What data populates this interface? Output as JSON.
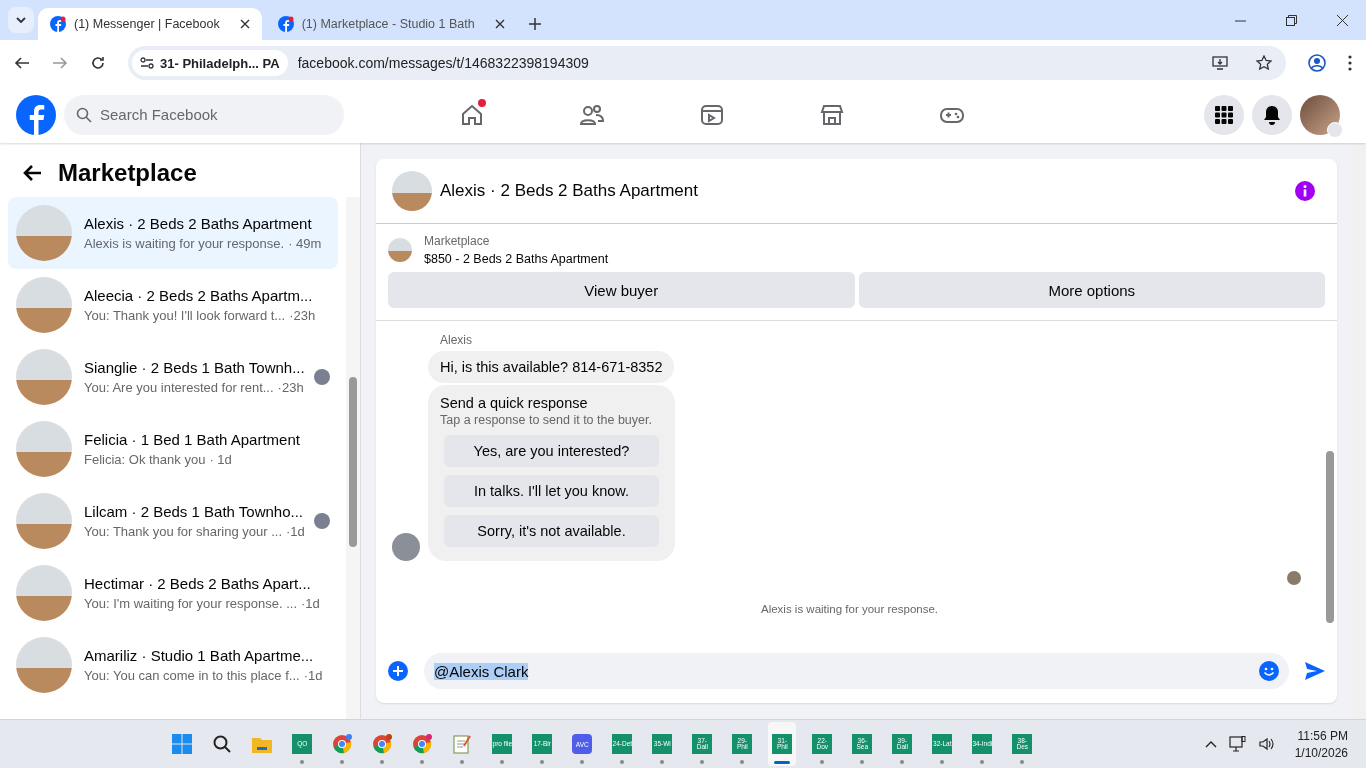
{
  "browser": {
    "tabs": [
      {
        "title": "(1) Messenger | Facebook",
        "selected": true
      },
      {
        "title": "(1) Marketplace - Studio 1 Bath",
        "selected": false
      }
    ],
    "site_chip": "31- Philadelph... PA",
    "url": "facebook.com/messages/t/1468322398194309"
  },
  "header": {
    "search": {
      "placeholder": "Search Facebook"
    },
    "nav": [
      {
        "kind": "home",
        "badge": true
      },
      {
        "kind": "friends",
        "badge": false
      },
      {
        "kind": "video",
        "badge": false
      },
      {
        "kind": "marketplace",
        "badge": false
      },
      {
        "kind": "gaming",
        "badge": false
      }
    ]
  },
  "sidebar": {
    "title": "Marketplace",
    "conversations": [
      {
        "title": "Alexis · 2 Beds 2 Baths Apartment",
        "preview": "Alexis is waiting for your response.",
        "time": "· 49m",
        "selected": true,
        "seen": false
      },
      {
        "title": "Aleecia · 2 Beds 2 Baths Apartm...",
        "preview": "You: Thank you! I'll look forward t...",
        "time": "·23h",
        "selected": false,
        "seen": false
      },
      {
        "title": "Sianglie · 2 Beds 1 Bath Townh...",
        "preview": "You: Are you interested for rent...",
        "time": "·23h",
        "selected": false,
        "seen": true
      },
      {
        "title": "Felicia · 1 Bed 1 Bath Apartment",
        "preview": "Felicia: Ok thank you",
        "time": "· 1d",
        "selected": false,
        "seen": false
      },
      {
        "title": "Lilcam · 2 Beds 1 Bath Townho...",
        "preview": "You: Thank you for sharing your ...",
        "time": "·1d",
        "selected": false,
        "seen": true
      },
      {
        "title": "Hectimar · 2 Beds 2 Baths Apart...",
        "preview": "You: I'm waiting for your response. ...",
        "time": "·1d",
        "selected": false,
        "seen": false
      },
      {
        "title": "Amariliz · Studio 1 Bath Apartme...",
        "preview": "You: You can come in to this place f...",
        "time": "·1d",
        "selected": false,
        "seen": false
      }
    ]
  },
  "chat": {
    "title": "Alexis · 2 Beds 2 Baths Apartment",
    "listing": {
      "label": "Marketplace",
      "name": "$850 - 2 Beds 2 Baths Apartment"
    },
    "actions": [
      "View buyer",
      "More options"
    ],
    "sender": "Alexis",
    "message": "Hi, is this available? 814-671-8352",
    "quick": {
      "title": "Send a quick response",
      "hint": "Tap a response to send it to the buyer.",
      "options": [
        "Yes, are you interested?",
        "In talks. I'll let you know.",
        "Sorry, it's not available."
      ]
    },
    "status": "Alexis is waiting for your response.",
    "composer": {
      "value": "@Alexis Clark",
      "selected": true
    }
  },
  "taskbar": {
    "apps": [
      {
        "kind": "start"
      },
      {
        "kind": "search"
      },
      {
        "kind": "folder"
      },
      {
        "kind": "tile",
        "label": "QO",
        "active": false
      },
      {
        "kind": "chrome",
        "color": "#3b82f6"
      },
      {
        "kind": "chrome",
        "color": "#c2410c"
      },
      {
        "kind": "chrome",
        "color": "#db2777"
      },
      {
        "kind": "notepad"
      },
      {
        "kind": "tile",
        "label": "pro file",
        "active": false
      },
      {
        "kind": "tile",
        "label": "17-Bir",
        "active": false
      },
      {
        "kind": "blue",
        "label": "AVC",
        "active": false
      },
      {
        "kind": "tile",
        "label": "24-Det",
        "active": false
      },
      {
        "kind": "tile",
        "label": "35-Wi",
        "active": false
      },
      {
        "kind": "tile",
        "label": "37-Dall",
        "active": false
      },
      {
        "kind": "tile",
        "label": "29-Phil",
        "active": false
      },
      {
        "kind": "tile",
        "label": "31-Phil",
        "active": true
      },
      {
        "kind": "tile",
        "label": "22-Dov",
        "active": false
      },
      {
        "kind": "tile",
        "label": "36-Sea",
        "active": false
      },
      {
        "kind": "tile",
        "label": "39-Dall",
        "active": false
      },
      {
        "kind": "tile",
        "label": "32-Lat",
        "active": false
      },
      {
        "kind": "tile",
        "label": "34-Indi",
        "active": false
      },
      {
        "kind": "tile",
        "label": "38-Des",
        "active": false
      }
    ],
    "time": "11:56 PM",
    "date": "1/10/2026"
  }
}
